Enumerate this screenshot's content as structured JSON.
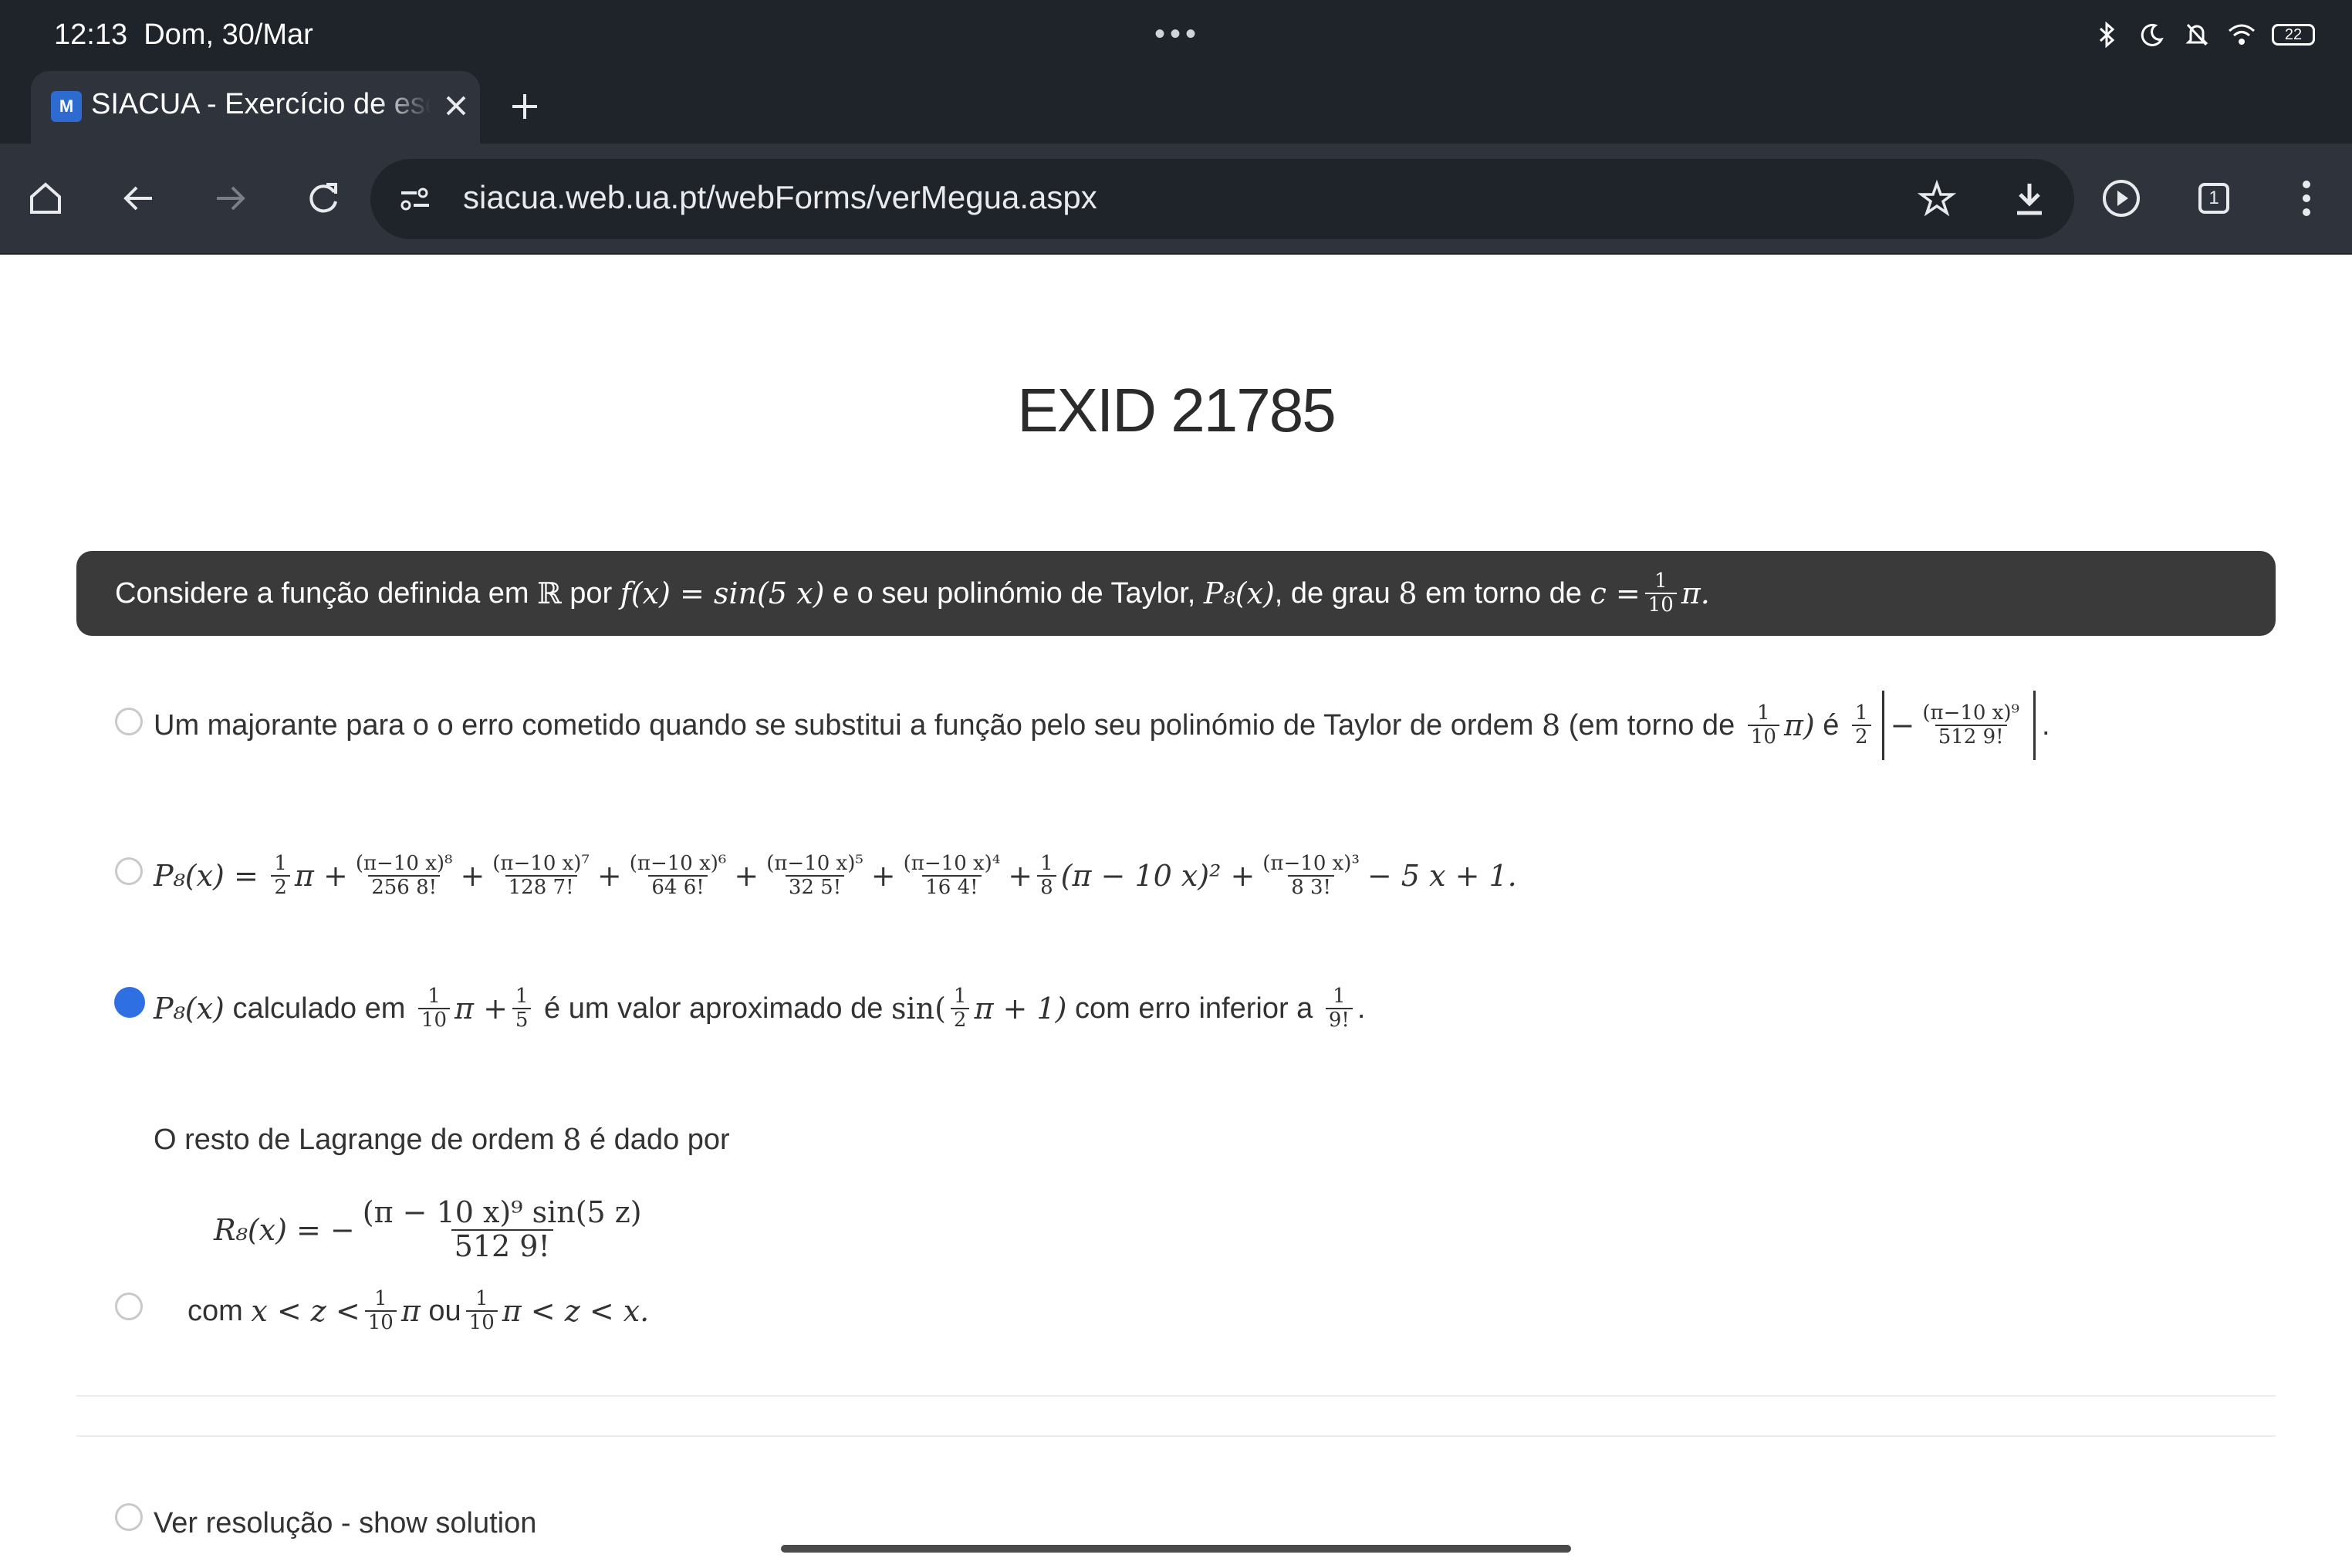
{
  "status_bar": {
    "time": "12:13",
    "date": "Dom, 30/Mar",
    "dots": "•••",
    "battery": "22",
    "icons": [
      "bluetooth-icon",
      "moon-icon",
      "bell-off-icon",
      "wifi-icon",
      "battery-icon"
    ]
  },
  "browser": {
    "tab_title": "SIACUA - Exercício de escolha múltipla",
    "favicon_text": "M",
    "url": "siacua.web.ua.pt/webForms/verMegua.aspx",
    "tab_count": "1",
    "accent_color": "#2f6fe4",
    "chrome_color": "#1f232a"
  },
  "page": {
    "title": "EXID 21785",
    "question": {
      "t1": "Considere a função definida em",
      "R": "ℝ",
      "t2": "por",
      "f": "f(x) = sin(5 x)",
      "t3": "e o seu polinómio de Taylor,",
      "P8": "P₈(x)",
      "t4": ", de grau",
      "deg": "8",
      "t5": "em torno de",
      "c": "c =",
      "c_num": "1",
      "c_den": "10",
      "pi": "π."
    },
    "options": [
      {
        "selected": false,
        "t1": "Um majorante para o o erro cometido quando se substitui a função pelo seu polinómio de Taylor de ordem",
        "ord": "8",
        "t2": "(em torno de",
        "a_num": "1",
        "a_den": "10",
        "a_pi": "π)",
        "t3": "é",
        "h_num": "1",
        "h_den": "2",
        "minus": "−",
        "e_num": "(π−10 x)⁹",
        "e_den": "512 9!",
        "end": "."
      },
      {
        "selected": false,
        "lhs": "P₈(x) =",
        "terms": [
          {
            "pre": "",
            "num": "1",
            "den": "2",
            "post": "π +"
          },
          {
            "pre": "",
            "num": "(π−10 x)⁸",
            "den": "256 8!",
            "post": "+"
          },
          {
            "pre": "",
            "num": "(π−10 x)⁷",
            "den": "128 7!",
            "post": "+"
          },
          {
            "pre": "",
            "num": "(π−10 x)⁶",
            "den": "64 6!",
            "post": "+"
          },
          {
            "pre": "",
            "num": "(π−10 x)⁵",
            "den": "32 5!",
            "post": "+"
          },
          {
            "pre": "",
            "num": "(π−10 x)⁴",
            "den": "16 4!",
            "post": "+"
          },
          {
            "pre": "",
            "num": "1",
            "den": "8",
            "post": "(π − 10 x)² +"
          },
          {
            "pre": "",
            "num": "(π−10 x)³",
            "den": "8 3!",
            "post": "− 5 x + 1."
          }
        ]
      },
      {
        "selected": true,
        "p": "P₈(x)",
        "t1": "calculado em",
        "a_num": "1",
        "a_den": "10",
        "a_mid": "π +",
        "b_num": "1",
        "b_den": "5",
        "t2": "é um valor aproximado de",
        "sin": "sin(",
        "s_num": "1",
        "s_den": "2",
        "s_post": "π + 1)",
        "t3": "com erro inferior a",
        "e_num": "1",
        "e_den": "9!",
        "end": "."
      },
      {
        "selected": false,
        "intro": "O resto de Lagrange de ordem",
        "ord": "8",
        "intro2": "é dado por",
        "lhs": "R₈(x) = −",
        "r_num": "(π − 10 x)⁹ sin(5 z)",
        "r_den": "512 9!",
        "c1": "com",
        "c2": "x < z <",
        "c_num": "1",
        "c_den": "10",
        "c3": "π",
        "c4": "ou",
        "d_num": "1",
        "d_den": "10",
        "c5": "π < z < x."
      }
    ],
    "show_solution": "Ver resolução - show solution"
  }
}
